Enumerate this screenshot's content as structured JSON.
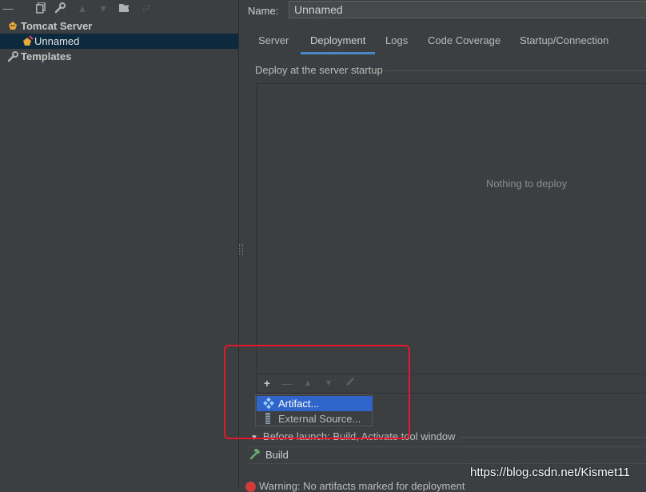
{
  "sidebar": {
    "toolbar_icons": [
      "minus-icon",
      "copy-icon",
      "wrench-icon",
      "arrow-up-icon",
      "arrow-down-icon",
      "new-folder-icon",
      "sort-icon"
    ],
    "tree": [
      {
        "label": "Tomcat Server",
        "icon": "tomcat-icon",
        "bold": true
      },
      {
        "label": "Unnamed",
        "icon": "tomcat-config-icon",
        "selected": true
      },
      {
        "label": "Templates",
        "icon": "wrench-icon",
        "bold": true
      }
    ]
  },
  "form": {
    "name_label": "Name:",
    "name_value": "Unnamed"
  },
  "tabs": [
    {
      "label": "Server",
      "active": false
    },
    {
      "label": "Deployment",
      "active": true
    },
    {
      "label": "Logs",
      "active": false
    },
    {
      "label": "Code Coverage",
      "active": false
    },
    {
      "label": "Startup/Connection",
      "active": false
    }
  ],
  "deployment": {
    "section_title": "Deploy at the server startup",
    "empty_text": "Nothing to deploy",
    "toolbar": [
      "add-icon",
      "remove-icon",
      "move-up-icon",
      "move-down-icon",
      "edit-icon"
    ]
  },
  "popup_menu": {
    "items": [
      {
        "label": "Artifact...",
        "icon": "artifact-icon",
        "selected": true
      },
      {
        "label": "External Source...",
        "icon": "external-source-icon",
        "selected": false
      }
    ]
  },
  "before_launch": {
    "title": "Before launch: Build, Activate tool window",
    "tasks": [
      {
        "label": "Build",
        "icon": "hammer-icon"
      }
    ]
  },
  "warning": {
    "text": "Warning: No artifacts marked for deployment"
  },
  "watermark": "https://blog.csdn.net/Kismet11",
  "colors": {
    "background": "#3c3f41",
    "selection": "#0d293e",
    "menu_selection": "#2f65ca",
    "tab_underline": "#4a88c7",
    "highlight_box": "#e0192b"
  }
}
